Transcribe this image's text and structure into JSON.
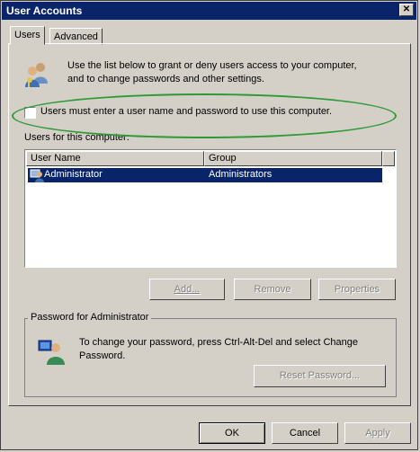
{
  "window": {
    "title": "User Accounts"
  },
  "tabs": [
    {
      "label": "Users"
    },
    {
      "label": "Advanced"
    }
  ],
  "intro": {
    "text": "Use the list below to grant or deny users access to your computer, and to change passwords and other settings."
  },
  "must_enter": {
    "label": "Users must enter a user name and password to use this computer.",
    "checked": false
  },
  "users_list": {
    "label": "Users for this computer:",
    "columns": [
      "User Name",
      "Group"
    ],
    "rows": [
      {
        "name": "Administrator",
        "group": "Administrators"
      }
    ]
  },
  "list_buttons": {
    "add": "Add...",
    "remove": "Remove",
    "properties": "Properties"
  },
  "password": {
    "legend": "Password for Administrator",
    "text": "To change your password, press Ctrl-Alt-Del and select Change Password.",
    "reset": "Reset Password..."
  },
  "footer": {
    "ok": "OK",
    "cancel": "Cancel",
    "apply": "Apply"
  },
  "colors": {
    "selection": "#0a246a",
    "highlight_ellipse": "#2e9a35"
  }
}
